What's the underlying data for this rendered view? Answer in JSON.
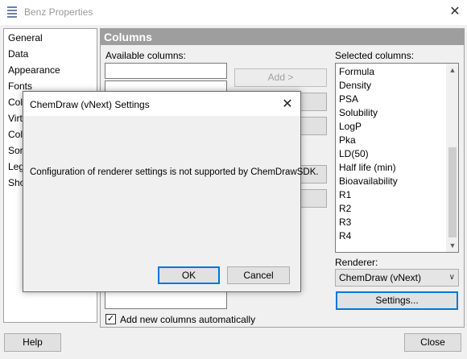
{
  "window": {
    "title": "Benz Properties",
    "close_glyph": "✕",
    "icon": "properties-icon"
  },
  "nav": {
    "items": [
      "General",
      "Data",
      "Appearance",
      "Fonts",
      "Colu",
      "Virtu",
      "Colo",
      "Sort",
      "Leg",
      "Sho"
    ]
  },
  "columns": {
    "header": "Columns",
    "available_label": "Available columns:",
    "selected_label": "Selected columns:",
    "add_label": "Add >",
    "selected_items": [
      "Formula",
      "Density",
      "PSA",
      "Solubility",
      "LogP",
      "Pka",
      "LD(50)",
      "Half life (min)",
      "Bioavailability",
      "R1",
      "R2",
      "R3",
      "R4"
    ],
    "renderer_label": "Renderer:",
    "renderer_value": "ChemDraw (vNext)",
    "settings_label": "Settings...",
    "auto_add_label": "Add new columns automatically",
    "auto_add_checked": true,
    "check_glyph": "✓"
  },
  "footer": {
    "help_label": "Help",
    "close_label": "Close"
  },
  "dialog": {
    "title": "ChemDraw (vNext) Settings",
    "close_glyph": "✕",
    "message": "Configuration of renderer settings is not supported by ChemDrawSDK.",
    "ok_label": "OK",
    "cancel_label": "Cancel"
  },
  "icons": {
    "scroll_up": "▲",
    "scroll_down": "▼",
    "dropdown": "∨"
  }
}
